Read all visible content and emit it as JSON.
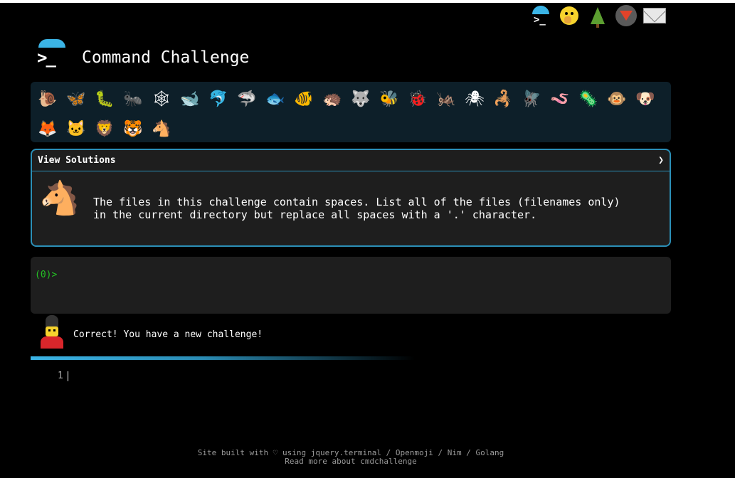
{
  "top_icons": [
    {
      "name": "terminal-icon",
      "glyph": ">_"
    },
    {
      "name": "shushing-face-icon",
      "glyph": ""
    },
    {
      "name": "evergreen-tree-icon",
      "glyph": ""
    },
    {
      "name": "gitlab-icon",
      "glyph": ""
    },
    {
      "name": "envelope-icon",
      "glyph": ""
    }
  ],
  "header": {
    "logo_prompt": ">_",
    "title": "Command Challenge"
  },
  "animals": [
    {
      "name": "snail-icon",
      "glyph": "🐌"
    },
    {
      "name": "butterfly-icon",
      "glyph": "🦋"
    },
    {
      "name": "caterpillar-icon",
      "glyph": "🐛"
    },
    {
      "name": "ant-icon",
      "glyph": "🐜"
    },
    {
      "name": "web-icon",
      "glyph": "🕸"
    },
    {
      "name": "whale-icon",
      "glyph": "🐋"
    },
    {
      "name": "dolphin-icon",
      "glyph": "🐬"
    },
    {
      "name": "shark-icon",
      "glyph": "🦈"
    },
    {
      "name": "fish-icon",
      "glyph": "🐟"
    },
    {
      "name": "tropical-fish-icon",
      "glyph": "🐠"
    },
    {
      "name": "hedgehog-icon",
      "glyph": "🦔"
    },
    {
      "name": "wolf-icon",
      "glyph": "🐺"
    },
    {
      "name": "bee-icon",
      "glyph": "🐝"
    },
    {
      "name": "ladybug-icon",
      "glyph": "🐞"
    },
    {
      "name": "cricket-icon",
      "glyph": "🦗"
    },
    {
      "name": "spider-icon",
      "glyph": "🕷"
    },
    {
      "name": "scorpion-icon",
      "glyph": "🦂"
    },
    {
      "name": "fly-icon",
      "glyph": "🪰"
    },
    {
      "name": "worm-icon",
      "glyph": "🪱"
    },
    {
      "name": "microbe-icon",
      "glyph": "🦠"
    },
    {
      "name": "monkey-icon",
      "glyph": "🐵"
    },
    {
      "name": "dog-icon",
      "glyph": "🐶"
    },
    {
      "name": "fox-icon",
      "glyph": "🦊"
    },
    {
      "name": "cat-icon",
      "glyph": "🐱"
    },
    {
      "name": "lion-icon",
      "glyph": "🦁"
    },
    {
      "name": "tiger-icon",
      "glyph": "🐯"
    },
    {
      "name": "horse-icon",
      "glyph": "🐴"
    }
  ],
  "solutions": {
    "header": "View Solutions",
    "chevron": "❯",
    "icon": "🐴",
    "description": "The files in this challenge contain spaces. List all of the files (filenames only)\nin the current directory but replace all spaces with a '.' character."
  },
  "terminal": {
    "prompt": "(0)>"
  },
  "status": {
    "message": "Correct! You have a new challenge!"
  },
  "progress": {
    "percent": 52
  },
  "editor": {
    "line_number": "1"
  },
  "footer": {
    "line1": "Site built with ♡ using jquery.terminal / Openmoji / Nim / Golang",
    "line2": "Read more about cmdchallenge"
  },
  "colors": {
    "accent": "#3bb4e6",
    "prompt": "#24c024",
    "panel_border": "#2b8fb7"
  }
}
